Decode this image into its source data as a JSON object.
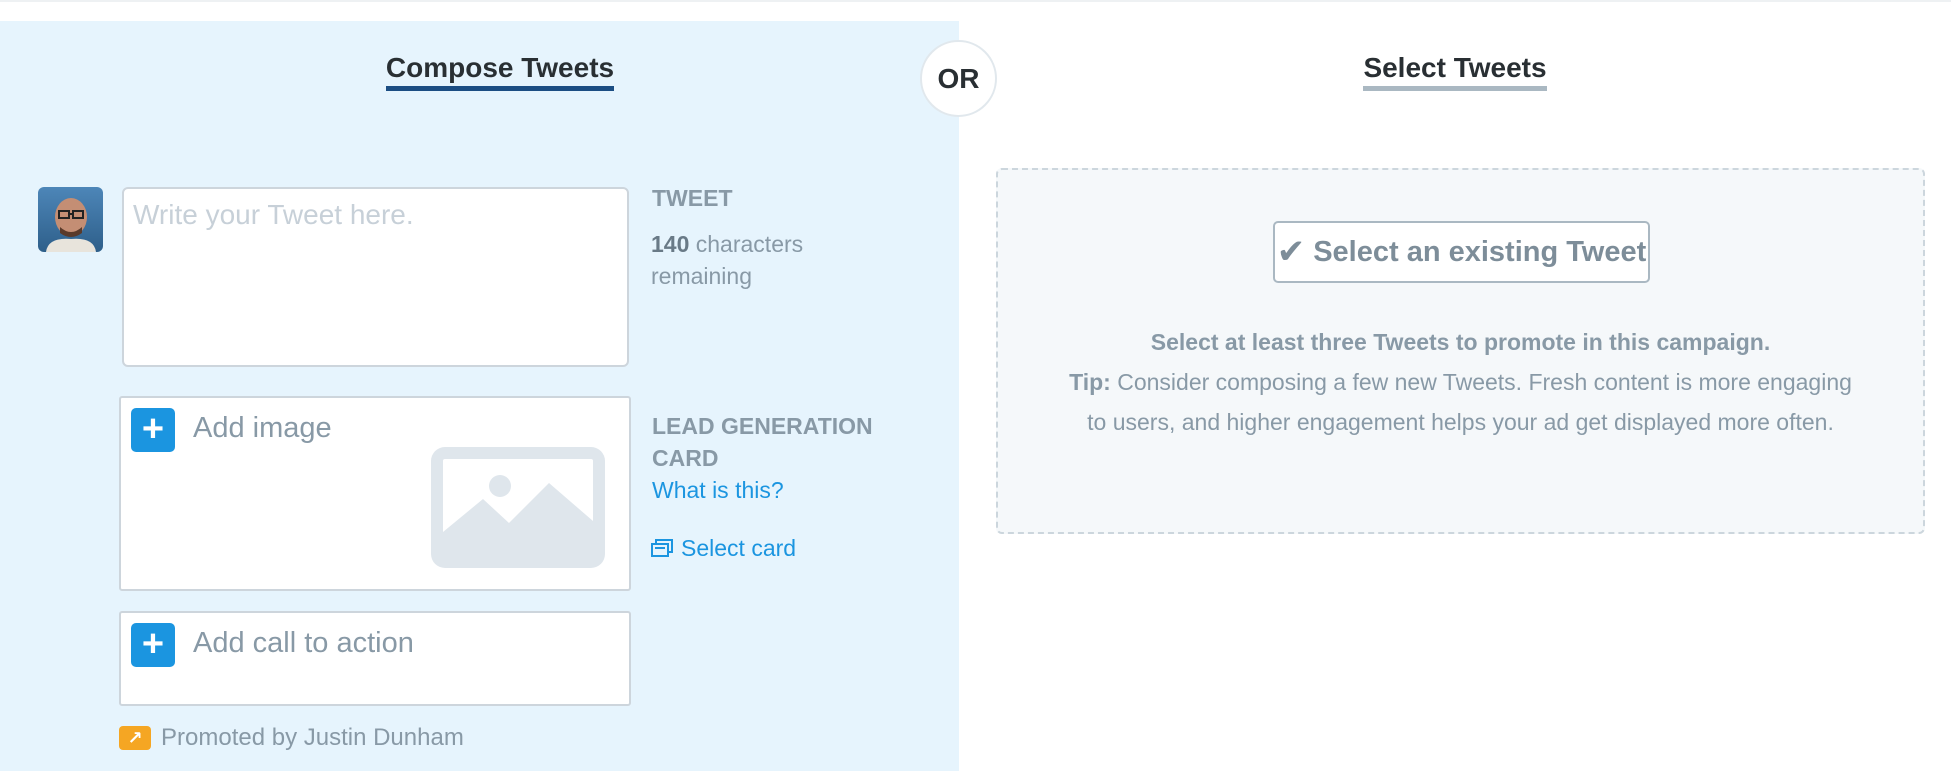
{
  "compose": {
    "title": "Compose Tweets",
    "tweet_placeholder": "Write your Tweet here.",
    "tweet_label": "TWEET",
    "char_count": "140",
    "char_suffix": " characters remaining",
    "add_image_label": "Add image",
    "lead_gen_label": "LEAD GENERATION CARD",
    "what_is_this": "What is this?",
    "select_card": "Select card",
    "add_cta_label": "Add call to action",
    "plus_symbol": "+",
    "promoted_by": "Promoted by Justin Dunham"
  },
  "or_label": "OR",
  "select": {
    "title": "Select Tweets",
    "button_label": "Select an existing Tweet",
    "button_icon": "✔",
    "instruction": "Select at least three Tweets to promote in this campaign.",
    "tip_label": "Tip:",
    "tip_text": " Consider composing a few new Tweets. Fresh content is more engaging to users, and higher engagement helps your ad get displayed more often."
  },
  "colors": {
    "compose_bg": "#e6f4fd",
    "accent_blue": "#1b95e0",
    "compose_underline": "#1b4d83",
    "select_underline": "#aab8c2",
    "promoted_orange": "#f5a623"
  },
  "icons": {
    "avatar": "user-avatar",
    "plus": "plus-icon",
    "image": "image-placeholder-icon",
    "card": "card-icon",
    "promoted": "promoted-arrow-icon",
    "check": "checkmark-icon"
  }
}
